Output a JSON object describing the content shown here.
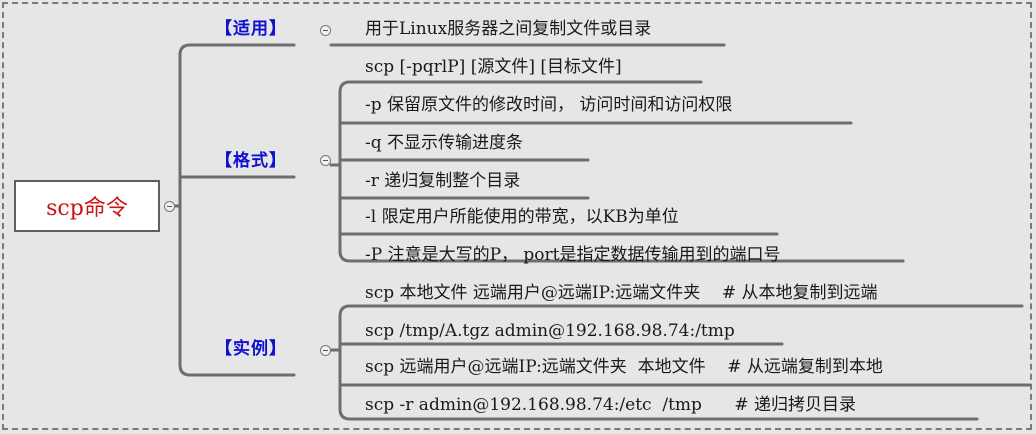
{
  "root": {
    "label": "scp命令"
  },
  "sections": [
    {
      "label": "【适用】",
      "items": [
        "用于Linux服务器之间复制文件或目录"
      ]
    },
    {
      "label": "【格式】",
      "items": [
        "scp [-pqrlP] [源文件] [目标文件]",
        "-p  保留原文件的修改时间， 访问时间和访问权限",
        "-q  不显示传输进度条",
        "-r  递归复制整个目录",
        "-l  限定用户所能使用的带宽，以KB为单位",
        "-P  注意是大写的P， port是指定数据传输用到的端口号"
      ]
    },
    {
      "label": "【实例】",
      "items": [
        "scp 本地文件 远端用户@远端IP:远端文件夹    # 从本地复制到远端",
        "scp /tmp/A.tgz admin@192.168.98.74:/tmp",
        "scp 远端用户@远端IP:远端文件夹  本地文件    # 从远端复制到本地",
        "scp -r admin@192.168.98.74:/etc  /tmp      # 递归拷贝目录"
      ]
    }
  ]
}
